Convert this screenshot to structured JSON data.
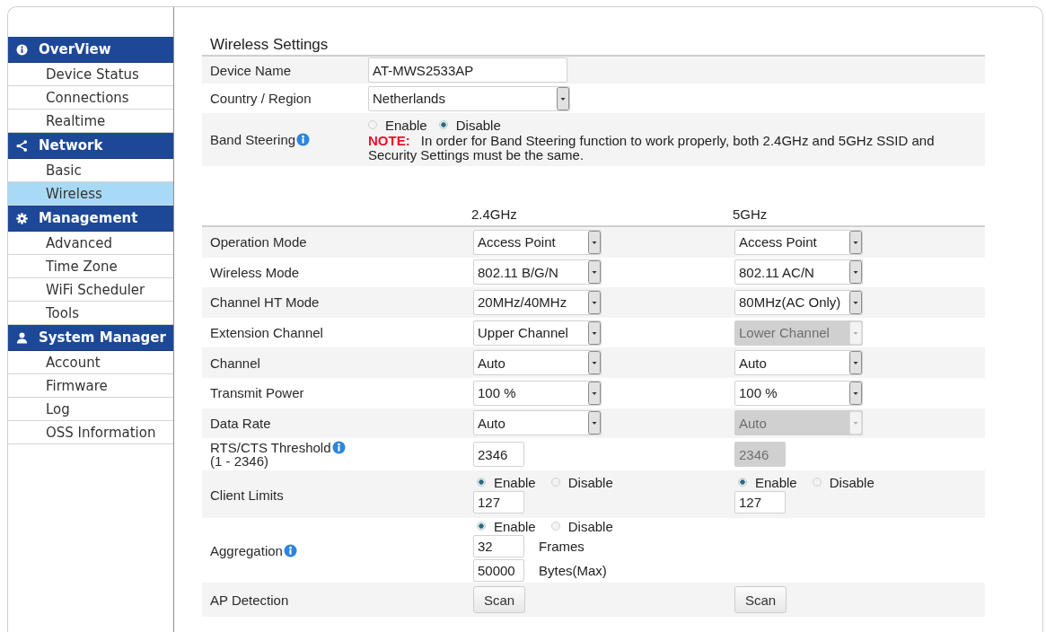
{
  "sidebar": {
    "sections": [
      {
        "title": "OverView",
        "items": [
          {
            "label": "Device Status",
            "selected": false
          },
          {
            "label": "Connections",
            "selected": false
          },
          {
            "label": "Realtime",
            "selected": false
          }
        ]
      },
      {
        "title": "Network",
        "items": [
          {
            "label": "Basic",
            "selected": false
          },
          {
            "label": "Wireless",
            "selected": true
          }
        ]
      },
      {
        "title": "Management",
        "items": [
          {
            "label": "Advanced",
            "selected": false
          },
          {
            "label": "Time Zone",
            "selected": false
          },
          {
            "label": "WiFi Scheduler",
            "selected": false
          },
          {
            "label": "Tools",
            "selected": false
          }
        ]
      },
      {
        "title": "System Manager",
        "items": [
          {
            "label": "Account",
            "selected": false
          },
          {
            "label": "Firmware",
            "selected": false
          },
          {
            "label": "Log",
            "selected": false
          },
          {
            "label": "OSS Information",
            "selected": false
          }
        ]
      }
    ]
  },
  "wireless_settings": {
    "title": "Wireless Settings",
    "fields": [
      {
        "kind": "text",
        "label": "Device Name",
        "info": false,
        "value": "AT-MWS2533AP"
      },
      {
        "kind": "select",
        "label": "Country / Region",
        "info": false,
        "value": "Netherlands"
      },
      {
        "kind": "radio",
        "label": "Band Steering",
        "info": true,
        "options": [
          {
            "label": "Enable",
            "selected": false
          },
          {
            "label": "Disable",
            "selected": true
          }
        ],
        "note": "**NOTE:** In order for Band Steering function to work properly, both 2.4GHz and 5GHz SSID and Security Settings must be the same."
      }
    ]
  },
  "radio_settings": {
    "columns": [
      "2.4GHz",
      "5GHz"
    ],
    "rows": [
      {
        "kind": "select",
        "label": "Operation Mode",
        "info": false,
        "cells": [
          {
            "value": "Access Point",
            "disabled": false
          },
          {
            "value": "Access Point",
            "disabled": false
          }
        ]
      },
      {
        "kind": "select",
        "label": "Wireless Mode",
        "info": false,
        "cells": [
          {
            "value": "802.11 B/G/N",
            "disabled": false
          },
          {
            "value": "802.11 AC/N",
            "disabled": false
          }
        ]
      },
      {
        "kind": "select",
        "label": "Channel HT Mode",
        "info": false,
        "cells": [
          {
            "value": "20MHz/40MHz",
            "disabled": false
          },
          {
            "value": "80MHz(AC Only)",
            "disabled": false
          }
        ]
      },
      {
        "kind": "select",
        "label": "Extension Channel",
        "info": false,
        "cells": [
          {
            "value": "Upper Channel",
            "disabled": false
          },
          {
            "value": "Lower Channel",
            "disabled": true
          }
        ]
      },
      {
        "kind": "select",
        "label": "Channel",
        "info": false,
        "cells": [
          {
            "value": "Auto",
            "disabled": false
          },
          {
            "value": "Auto",
            "disabled": false
          }
        ]
      },
      {
        "kind": "select",
        "label": "Transmit Power",
        "info": false,
        "cells": [
          {
            "value": "100 %",
            "disabled": false
          },
          {
            "value": "100 %",
            "disabled": false
          }
        ]
      },
      {
        "kind": "select",
        "label": "Data Rate",
        "info": false,
        "cells": [
          {
            "value": "Auto",
            "disabled": false
          },
          {
            "value": "Auto",
            "disabled": true
          }
        ]
      },
      {
        "kind": "text",
        "label": "RTS/CTS Threshold",
        "hint": "(1 - 2346)",
        "info": true,
        "cells": [
          {
            "value": "2346",
            "disabled": false
          },
          {
            "value": "2346",
            "disabled": true
          }
        ]
      },
      {
        "kind": "toggle",
        "label": "Client Limits",
        "info": false,
        "cells": [
          {
            "options": [
              {
                "label": "Enable",
                "selected": true
              },
              {
                "label": "Disable",
                "selected": false
              }
            ],
            "inputs": [
              {
                "value": "127"
              }
            ]
          },
          {
            "options": [
              {
                "label": "Enable",
                "selected": true
              },
              {
                "label": "Disable",
                "selected": false
              }
            ],
            "inputs": [
              {
                "value": "127"
              }
            ]
          }
        ]
      },
      {
        "kind": "toggle",
        "label": "Aggregation",
        "info": true,
        "cells": [
          {
            "options": [
              {
                "label": "Enable",
                "selected": true
              },
              {
                "label": "Disable",
                "selected": false
              }
            ],
            "inputs": [
              {
                "value": "32",
                "unit": "Frames"
              },
              {
                "value": "50000",
                "unit": "Bytes(Max)"
              }
            ]
          }
        ]
      },
      {
        "kind": "button",
        "label": "AP Detection",
        "info": false,
        "cells": [
          {
            "label": "Scan"
          },
          {
            "label": "Scan"
          }
        ]
      }
    ]
  }
}
